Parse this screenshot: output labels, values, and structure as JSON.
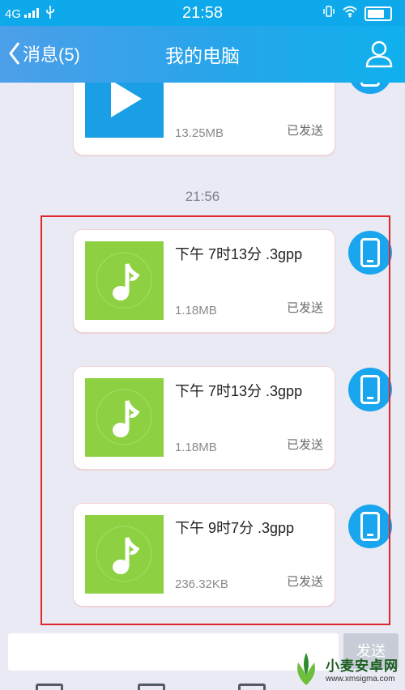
{
  "status_bar": {
    "network": "4G",
    "time": "21:58"
  },
  "header": {
    "back_label": "消息(5)",
    "title": "我的电脑"
  },
  "messages_above": [
    {
      "type": "video",
      "size": "13.25MB",
      "status": "已发送"
    }
  ],
  "time_separator": "21:56",
  "messages": [
    {
      "type": "audio",
      "name": "下午 7时13分 .3gpp",
      "size": "1.18MB",
      "status": "已发送"
    },
    {
      "type": "audio",
      "name": "下午 7时13分 .3gpp",
      "size": "1.18MB",
      "status": "已发送"
    },
    {
      "type": "audio",
      "name": "下午 9时7分 .3gpp",
      "size": "236.32KB",
      "status": "已发送"
    }
  ],
  "input": {
    "placeholder": "",
    "send_label": "发送"
  },
  "watermark": {
    "title": "小麦安卓网",
    "url": "www.xmsigma.com"
  },
  "colors": {
    "header": "#2aa4ea",
    "audio_thumb": "#8dd142",
    "video_thumb": "#1a9fe6",
    "avatar": "#1aa6ee",
    "selection": "#e2262b"
  }
}
